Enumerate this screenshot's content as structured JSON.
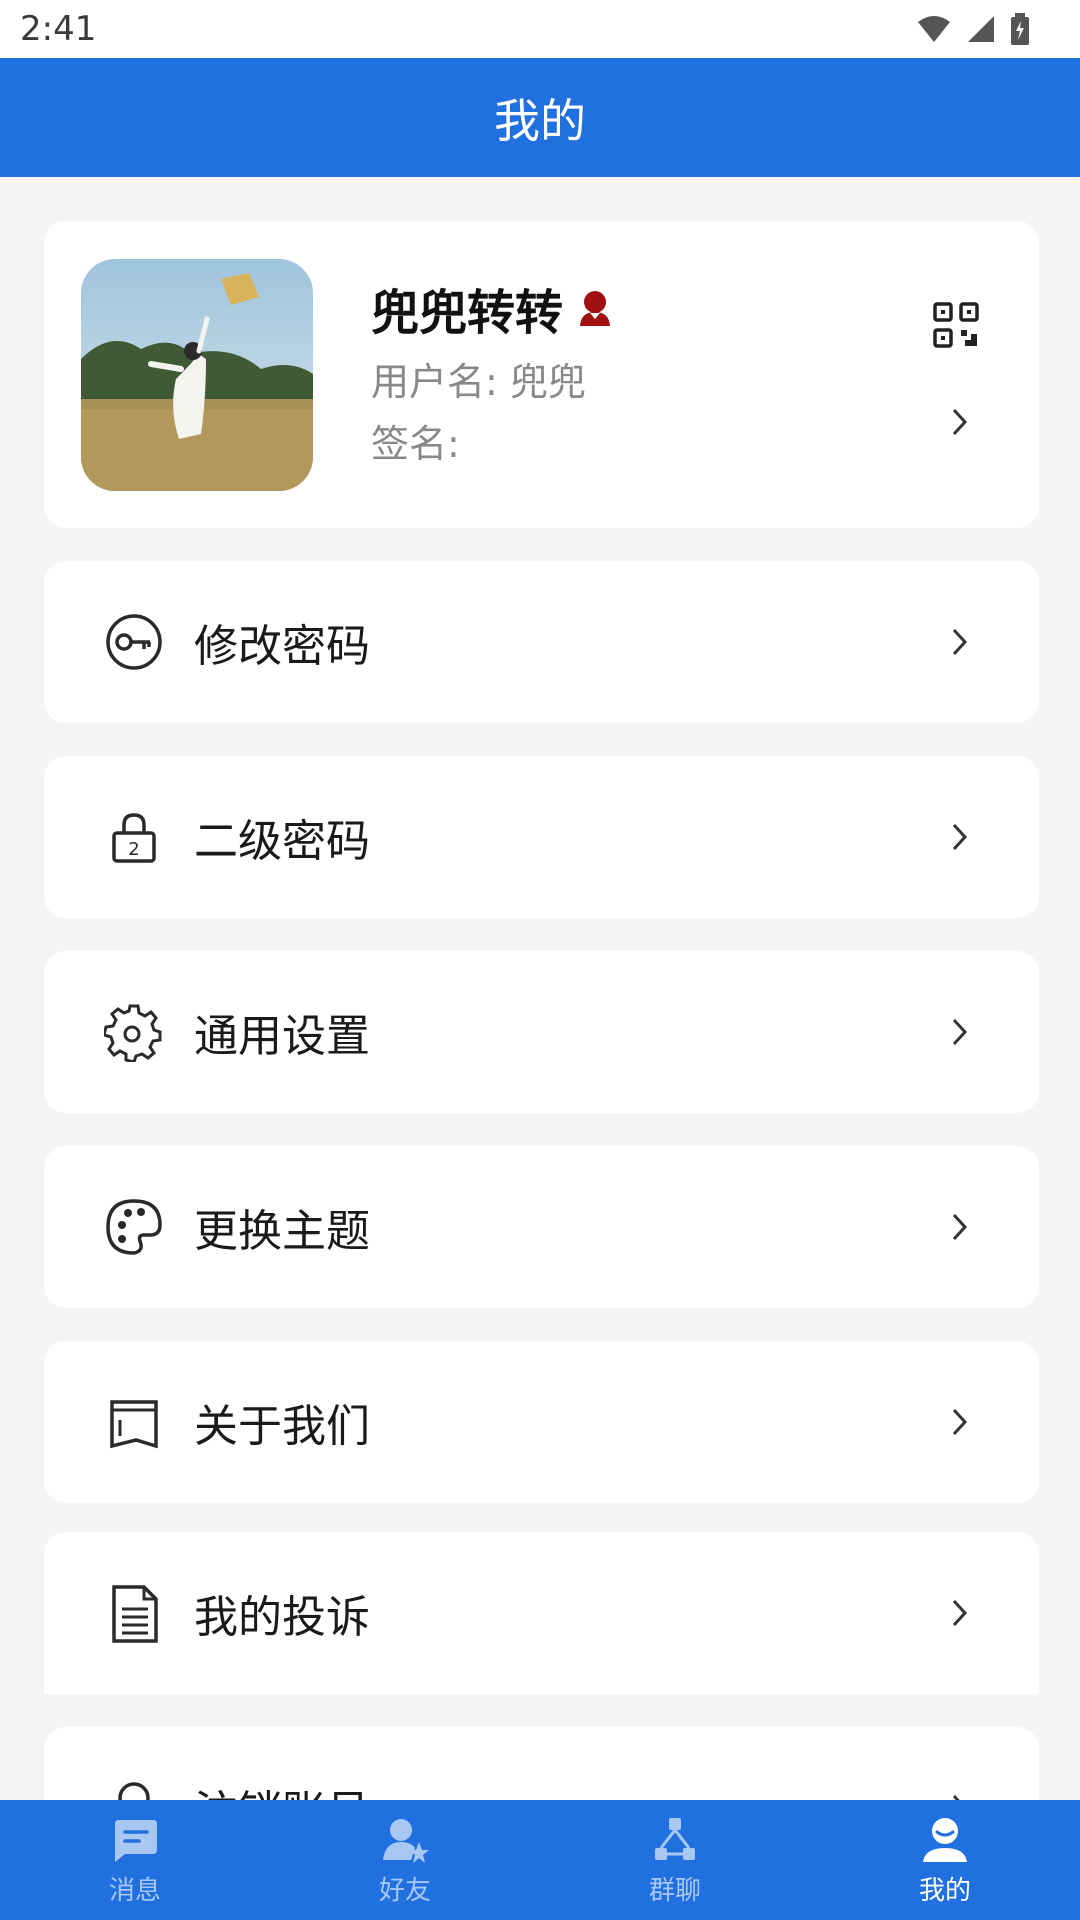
{
  "status_bar": {
    "time": "2:41"
  },
  "header": {
    "title": "我的"
  },
  "profile": {
    "name": "兜兜转转",
    "username": "用户名: 兜兜",
    "signature": "签名:"
  },
  "menu": [
    {
      "label": "修改密码",
      "icon": "key-icon"
    },
    {
      "label": "二级密码",
      "icon": "lock-icon"
    },
    {
      "label": "通用设置",
      "icon": "gear-icon"
    },
    {
      "label": "更换主题",
      "icon": "palette-icon"
    },
    {
      "label": "关于我们",
      "icon": "book-icon"
    },
    {
      "label": "我的投诉",
      "icon": "document-icon"
    },
    {
      "label": "注销账号",
      "icon": "user-icon"
    }
  ],
  "tabs": [
    {
      "label": "消息",
      "icon": "chat-icon",
      "active": false
    },
    {
      "label": "好友",
      "icon": "friends-icon",
      "active": false
    },
    {
      "label": "群聊",
      "icon": "group-icon",
      "active": false
    },
    {
      "label": "我的",
      "icon": "person-icon",
      "active": true
    }
  ],
  "colors": {
    "primary": "#2170e0",
    "gender_badge": "#a01010"
  }
}
